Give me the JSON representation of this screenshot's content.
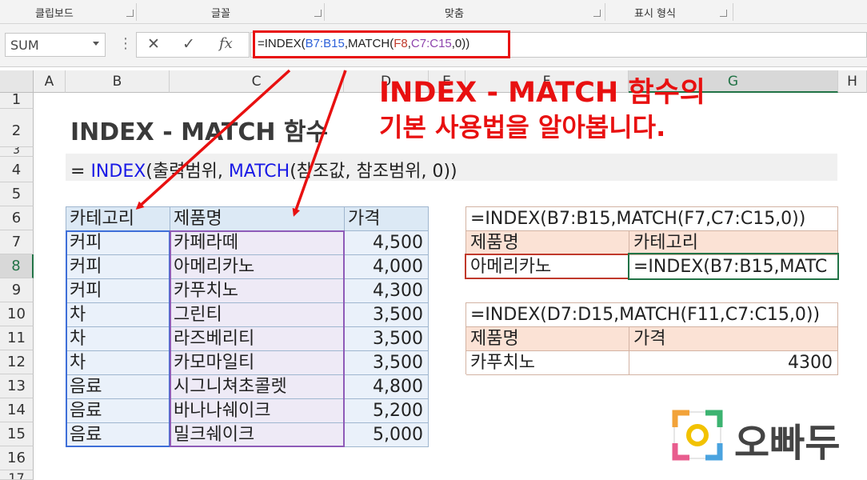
{
  "ribbon": {
    "groups": [
      "클립보드",
      "글꼴",
      "맞춤",
      "표시 형식"
    ]
  },
  "formula_bar": {
    "name_box": "SUM",
    "formula_parts": [
      {
        "t": "=INDEX(",
        "c": "#222222"
      },
      {
        "t": "B7:B15",
        "c": "#2b5fd9"
      },
      {
        "t": ",MATCH(",
        "c": "#222222"
      },
      {
        "t": "F8",
        "c": "#c0392b"
      },
      {
        "t": ",",
        "c": "#222222"
      },
      {
        "t": "C7:C15",
        "c": "#8e44ad"
      },
      {
        "t": ",0))",
        "c": "#222222"
      }
    ],
    "cancel_icon": "✕",
    "enter_icon": "✓",
    "fx_icon": "fx"
  },
  "columns": [
    "A",
    "B",
    "C",
    "D",
    "E",
    "F",
    "G",
    "H"
  ],
  "rows": [
    "1",
    "2",
    "3",
    "4",
    "5",
    "6",
    "7",
    "8",
    "9",
    "10",
    "11",
    "12",
    "13",
    "14",
    "15",
    "16",
    "17"
  ],
  "title": "INDEX - MATCH 함수",
  "syntax": {
    "eq": "= ",
    "index": "INDEX",
    "mid": "(출력범위, ",
    "match": "MATCH",
    "tail": "(참조값, 참조범위, 0))"
  },
  "table": {
    "headers": [
      "카테고리",
      "제품명",
      "가격"
    ],
    "rows": [
      [
        "커피",
        "카페라떼",
        "4,500"
      ],
      [
        "커피",
        "아메리카노",
        "4,000"
      ],
      [
        "커피",
        "카푸치노",
        "4,300"
      ],
      [
        "차",
        "그린티",
        "3,500"
      ],
      [
        "차",
        "라즈베리티",
        "3,500"
      ],
      [
        "차",
        "카모마일티",
        "3,500"
      ],
      [
        "음료",
        "시그니쳐초콜렛",
        "4,800"
      ],
      [
        "음료",
        "바나나쉐이크",
        "5,200"
      ],
      [
        "음료",
        "밀크쉐이크",
        "5,000"
      ]
    ]
  },
  "lookup1": {
    "formula": "=INDEX(B7:B15,MATCH(F7,C7:C15,0))",
    "header_left": "제품명",
    "header_right": "카테고리",
    "value_left": "아메리카노",
    "value_right": "=INDEX(B7:B15,MATC"
  },
  "lookup2": {
    "formula": "=INDEX(D7:D15,MATCH(F11,C7:C15,0))",
    "header_left": "제품명",
    "header_right": "가격",
    "value_left": "카푸치노",
    "value_right": "4300"
  },
  "annotation": {
    "line1": "INDEX - MATCH 함수의",
    "line2": "기본 사용법을 알아봅니다."
  },
  "logo": {
    "text": "오빠두"
  },
  "colors": {
    "accent_red": "#e81010",
    "header_blue": "#dce9f5",
    "header_peach": "#fbe2d5",
    "selection_green": "#217346"
  }
}
